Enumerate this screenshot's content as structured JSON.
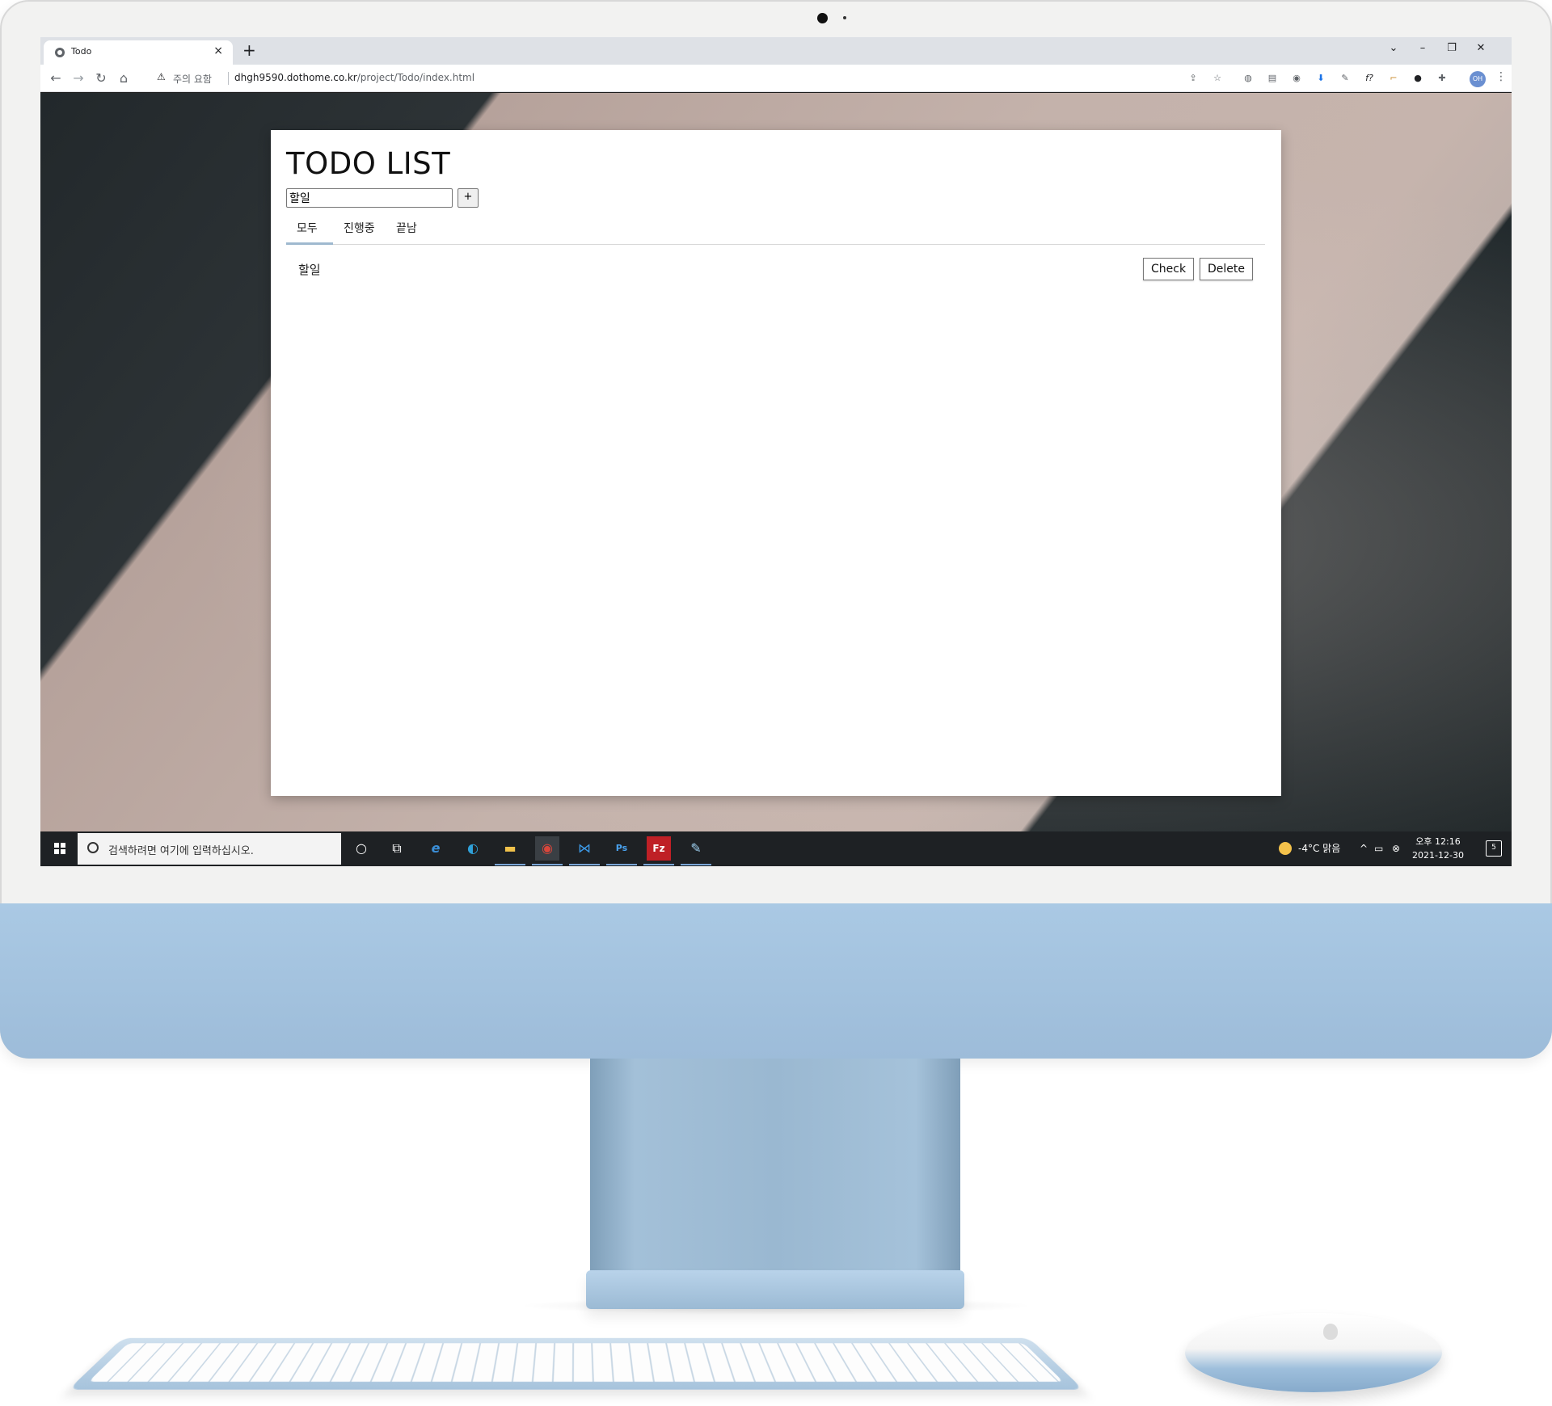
{
  "browser": {
    "tab_title": "Todo",
    "tab_close": "×",
    "new_tab": "+",
    "window_controls": {
      "chevron": "⌄",
      "minimize": "–",
      "restore": "❐",
      "close": "✕"
    },
    "nav": {
      "back": "←",
      "forward": "→",
      "reload": "↻",
      "home": "⌂"
    },
    "security_icon": "⚠",
    "security_text": "주의 요함",
    "url_host": "dhgh9590.dothome.co.kr",
    "url_path": "/project/Todo/index.html",
    "extensions": [
      "share-icon",
      "star-icon",
      "globe-icon",
      "reading-list-icon",
      "camera-icon",
      "download-icon",
      "eyedropper-icon",
      "font-icon",
      "hammer-icon",
      "panda-icon",
      "puzzle-icon"
    ],
    "extension_glyphs": {
      "share": "⇪",
      "star": "☆",
      "globe": "◍",
      "reading": "▤",
      "camera": "◉",
      "download": "⬇",
      "eyedropper": "✎",
      "font": "f?",
      "hammer": "⌐",
      "panda": "●",
      "puzzle": "✚"
    },
    "profile_initials": "OH",
    "menu": "⋮"
  },
  "app": {
    "title": "TODO LIST",
    "input_value": "할일",
    "add_button": "+",
    "tabs": [
      {
        "label": "모두",
        "active": true
      },
      {
        "label": "진행중",
        "active": false
      },
      {
        "label": "끝남",
        "active": false
      }
    ],
    "tasks": [
      {
        "text": "할일",
        "check_label": "Check",
        "delete_label": "Delete"
      }
    ]
  },
  "taskbar": {
    "search_placeholder": "검색하려면 여기에 입력하십시오.",
    "cortana": "○",
    "task_view": "⧉",
    "apps": [
      "internet-explorer-icon",
      "edge-icon",
      "file-explorer-icon",
      "chrome-icon",
      "vscode-icon",
      "photoshop-icon",
      "filezilla-icon",
      "paint-icon"
    ],
    "app_glyphs": {
      "ie": "e",
      "edge": "◐",
      "explorer": "▬",
      "chrome": "◉",
      "vscode": "⋈",
      "photoshop": "Ps",
      "filezilla": "Fz",
      "paint": "✎"
    },
    "weather": "-4°C 맑음",
    "tray_up": "^",
    "tray_network": "▭",
    "tray_sound": "⊗",
    "clock_time": "오후 12:16",
    "clock_date": "2021-12-30",
    "notification_count": "5"
  },
  "colors": {
    "bezel": "#f2f2f1",
    "chin": "#a8c6e2",
    "tab_indicator": "#9fb9cf",
    "taskbar": "#1e2124"
  }
}
